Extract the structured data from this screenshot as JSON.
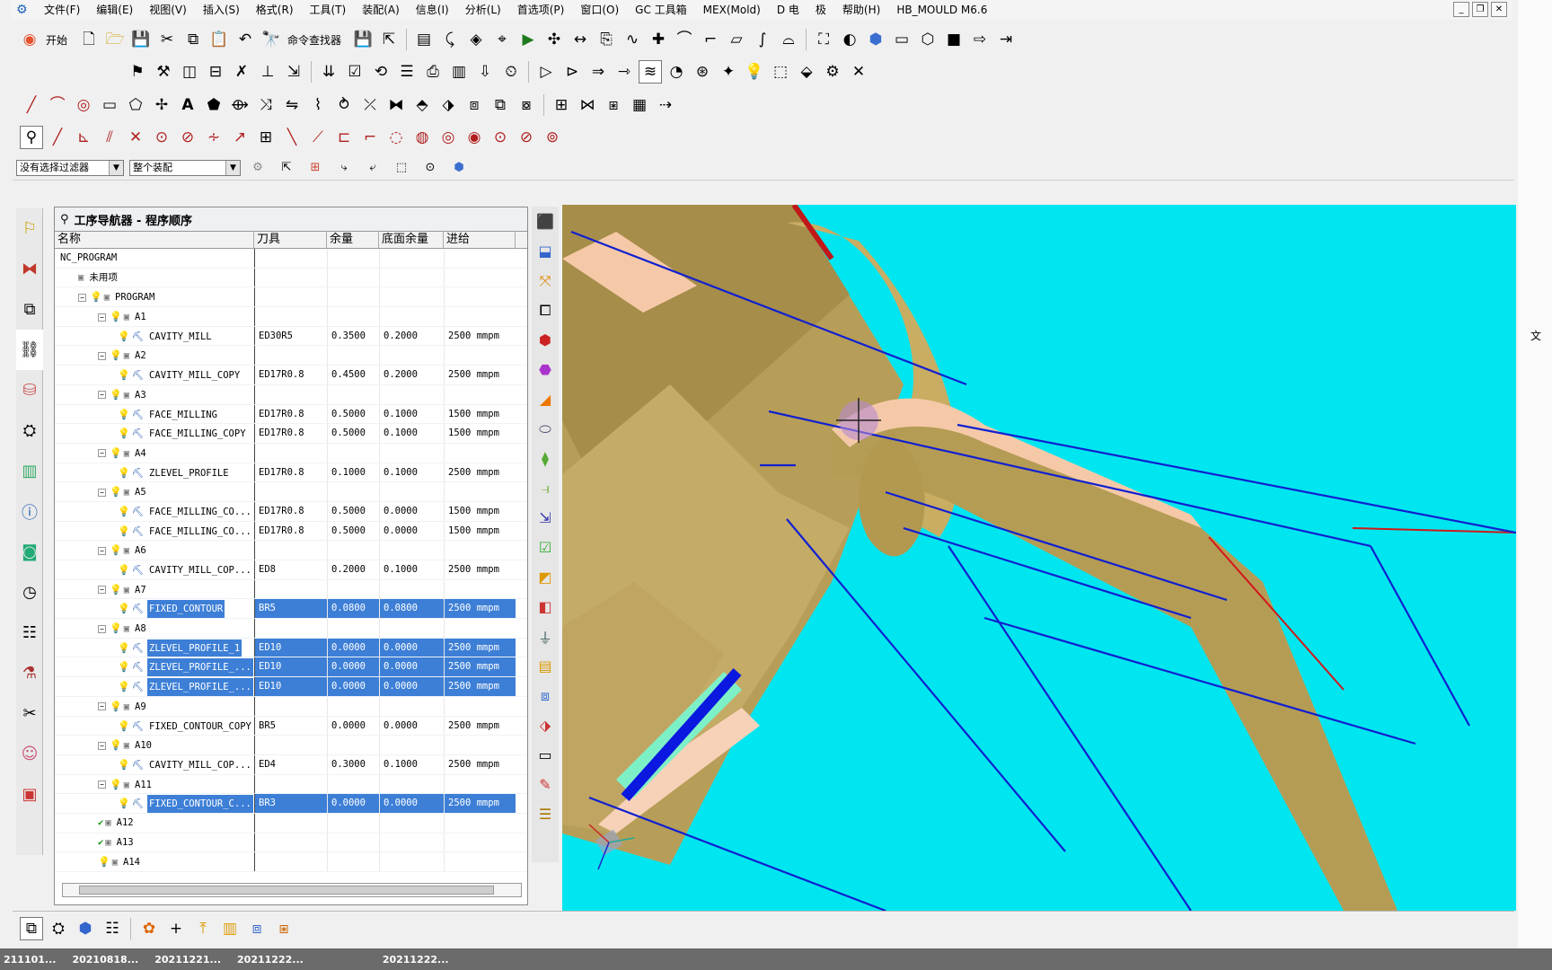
{
  "menubar": {
    "items": [
      "文件(F)",
      "编辑(E)",
      "视图(V)",
      "插入(S)",
      "格式(R)",
      "工具(T)",
      "装配(A)",
      "信息(I)",
      "分析(L)",
      "首选项(P)",
      "窗口(O)",
      "GC 工具箱",
      "MEX(Mold)",
      "D 电",
      "极",
      "帮助(H)",
      "HB_MOULD M6.6"
    ]
  },
  "toolbar": {
    "start_label": "开始",
    "command_finder_label": "命令查找器"
  },
  "filter_bar": {
    "selection_filter": "没有选择过滤器",
    "assembly_scope": "整个装配"
  },
  "navigator": {
    "title": "工序导航器 - 程序顺序",
    "columns": [
      "名称",
      "刀具",
      "余量",
      "底面余量",
      "进给"
    ],
    "rows": [
      {
        "name": "NC_PROGRAM",
        "tool": "",
        "stock": "",
        "floor": "",
        "feed": "",
        "level": 0,
        "kind": "root",
        "selected": false,
        "toggle": ""
      },
      {
        "name": "未用项",
        "tool": "",
        "stock": "",
        "floor": "",
        "feed": "",
        "level": 1,
        "kind": "folder",
        "selected": false,
        "toggle": ""
      },
      {
        "name": "PROGRAM",
        "tool": "",
        "stock": "",
        "floor": "",
        "feed": "",
        "level": 1,
        "kind": "group",
        "selected": false,
        "toggle": "−"
      },
      {
        "name": "A1",
        "tool": "",
        "stock": "",
        "floor": "",
        "feed": "",
        "level": 2,
        "kind": "group",
        "selected": false,
        "toggle": "−"
      },
      {
        "name": "CAVITY_MILL",
        "tool": "ED30R5",
        "stock": "0.3500",
        "floor": "0.2000",
        "feed": "2500 mmpm",
        "level": 3,
        "kind": "op",
        "selected": false,
        "toggle": ""
      },
      {
        "name": "A2",
        "tool": "",
        "stock": "",
        "floor": "",
        "feed": "",
        "level": 2,
        "kind": "group",
        "selected": false,
        "toggle": "−"
      },
      {
        "name": "CAVITY_MILL_COPY",
        "tool": "ED17R0.8",
        "stock": "0.4500",
        "floor": "0.2000",
        "feed": "2500 mmpm",
        "level": 3,
        "kind": "op",
        "selected": false,
        "toggle": ""
      },
      {
        "name": "A3",
        "tool": "",
        "stock": "",
        "floor": "",
        "feed": "",
        "level": 2,
        "kind": "group",
        "selected": false,
        "toggle": "−"
      },
      {
        "name": "FACE_MILLING",
        "tool": "ED17R0.8",
        "stock": "0.5000",
        "floor": "0.1000",
        "feed": "1500 mmpm",
        "level": 3,
        "kind": "op",
        "selected": false,
        "toggle": ""
      },
      {
        "name": "FACE_MILLING_COPY",
        "tool": "ED17R0.8",
        "stock": "0.5000",
        "floor": "0.1000",
        "feed": "1500 mmpm",
        "level": 3,
        "kind": "op",
        "selected": false,
        "toggle": ""
      },
      {
        "name": "A4",
        "tool": "",
        "stock": "",
        "floor": "",
        "feed": "",
        "level": 2,
        "kind": "group",
        "selected": false,
        "toggle": "−"
      },
      {
        "name": "ZLEVEL_PROFILE",
        "tool": "ED17R0.8",
        "stock": "0.1000",
        "floor": "0.1000",
        "feed": "2500 mmpm",
        "level": 3,
        "kind": "op",
        "selected": false,
        "toggle": ""
      },
      {
        "name": "A5",
        "tool": "",
        "stock": "",
        "floor": "",
        "feed": "",
        "level": 2,
        "kind": "group",
        "selected": false,
        "toggle": "−"
      },
      {
        "name": "FACE_MILLING_CO...",
        "tool": "ED17R0.8",
        "stock": "0.5000",
        "floor": "0.0000",
        "feed": "1500 mmpm",
        "level": 3,
        "kind": "op",
        "selected": false,
        "toggle": ""
      },
      {
        "name": "FACE_MILLING_CO...",
        "tool": "ED17R0.8",
        "stock": "0.5000",
        "floor": "0.0000",
        "feed": "1500 mmpm",
        "level": 3,
        "kind": "op",
        "selected": false,
        "toggle": ""
      },
      {
        "name": "A6",
        "tool": "",
        "stock": "",
        "floor": "",
        "feed": "",
        "level": 2,
        "kind": "group",
        "selected": false,
        "toggle": "−"
      },
      {
        "name": "CAVITY_MILL_COP...",
        "tool": "ED8",
        "stock": "0.2000",
        "floor": "0.1000",
        "feed": "2500 mmpm",
        "level": 3,
        "kind": "op",
        "selected": false,
        "toggle": ""
      },
      {
        "name": "A7",
        "tool": "",
        "stock": "",
        "floor": "",
        "feed": "",
        "level": 2,
        "kind": "group",
        "selected": false,
        "toggle": "−"
      },
      {
        "name": "FIXED_CONTOUR",
        "tool": "BR5",
        "stock": "0.0800",
        "floor": "0.0800",
        "feed": "2500 mmpm",
        "level": 3,
        "kind": "op",
        "selected": true,
        "toggle": ""
      },
      {
        "name": "A8",
        "tool": "",
        "stock": "",
        "floor": "",
        "feed": "",
        "level": 2,
        "kind": "group",
        "selected": false,
        "toggle": "−"
      },
      {
        "name": "ZLEVEL_PROFILE_1",
        "tool": "ED10",
        "stock": "0.0000",
        "floor": "0.0000",
        "feed": "2500 mmpm",
        "level": 3,
        "kind": "op",
        "selected": true,
        "toggle": ""
      },
      {
        "name": "ZLEVEL_PROFILE_...",
        "tool": "ED10",
        "stock": "0.0000",
        "floor": "0.0000",
        "feed": "2500 mmpm",
        "level": 3,
        "kind": "op",
        "selected": true,
        "toggle": ""
      },
      {
        "name": "ZLEVEL_PROFILE_...",
        "tool": "ED10",
        "stock": "0.0000",
        "floor": "0.0000",
        "feed": "2500 mmpm",
        "level": 3,
        "kind": "op",
        "selected": true,
        "toggle": ""
      },
      {
        "name": "A9",
        "tool": "",
        "stock": "",
        "floor": "",
        "feed": "",
        "level": 2,
        "kind": "group",
        "selected": false,
        "toggle": "−"
      },
      {
        "name": "FIXED_CONTOUR_COPY",
        "tool": "BR5",
        "stock": "0.0000",
        "floor": "0.0000",
        "feed": "2500 mmpm",
        "level": 3,
        "kind": "op",
        "selected": false,
        "toggle": ""
      },
      {
        "name": "A10",
        "tool": "",
        "stock": "",
        "floor": "",
        "feed": "",
        "level": 2,
        "kind": "group",
        "selected": false,
        "toggle": "−"
      },
      {
        "name": "CAVITY_MILL_COP...",
        "tool": "ED4",
        "stock": "0.3000",
        "floor": "0.1000",
        "feed": "2500 mmpm",
        "level": 3,
        "kind": "op",
        "selected": false,
        "toggle": ""
      },
      {
        "name": "A11",
        "tool": "",
        "stock": "",
        "floor": "",
        "feed": "",
        "level": 2,
        "kind": "group",
        "selected": false,
        "toggle": "−"
      },
      {
        "name": "FIXED_CONTOUR_C...",
        "tool": "BR3",
        "stock": "0.0000",
        "floor": "0.0000",
        "feed": "2500 mmpm",
        "level": 3,
        "kind": "op",
        "selected": true,
        "toggle": ""
      },
      {
        "name": "A12",
        "tool": "",
        "stock": "",
        "floor": "",
        "feed": "",
        "level": 2,
        "kind": "done",
        "selected": false,
        "toggle": ""
      },
      {
        "name": "A13",
        "tool": "",
        "stock": "",
        "floor": "",
        "feed": "",
        "level": 2,
        "kind": "done",
        "selected": false,
        "toggle": ""
      },
      {
        "name": "A14",
        "tool": "",
        "stock": "",
        "floor": "",
        "feed": "",
        "level": 2,
        "kind": "group",
        "selected": false,
        "toggle": ""
      }
    ]
  },
  "viewport": {
    "background_color": "#00e6f0",
    "part_color": "#c8b06a",
    "toolpath_color": "#1020d0",
    "cursor_icon": "crosshair-cursor-icon",
    "triad_icon": "wcs-triad-icon"
  },
  "taskbar": {
    "items": [
      "211101...",
      "20210818...",
      "20211221...",
      "20211222...",
      "20211222..."
    ]
  },
  "right_edge": {
    "label": "文"
  }
}
